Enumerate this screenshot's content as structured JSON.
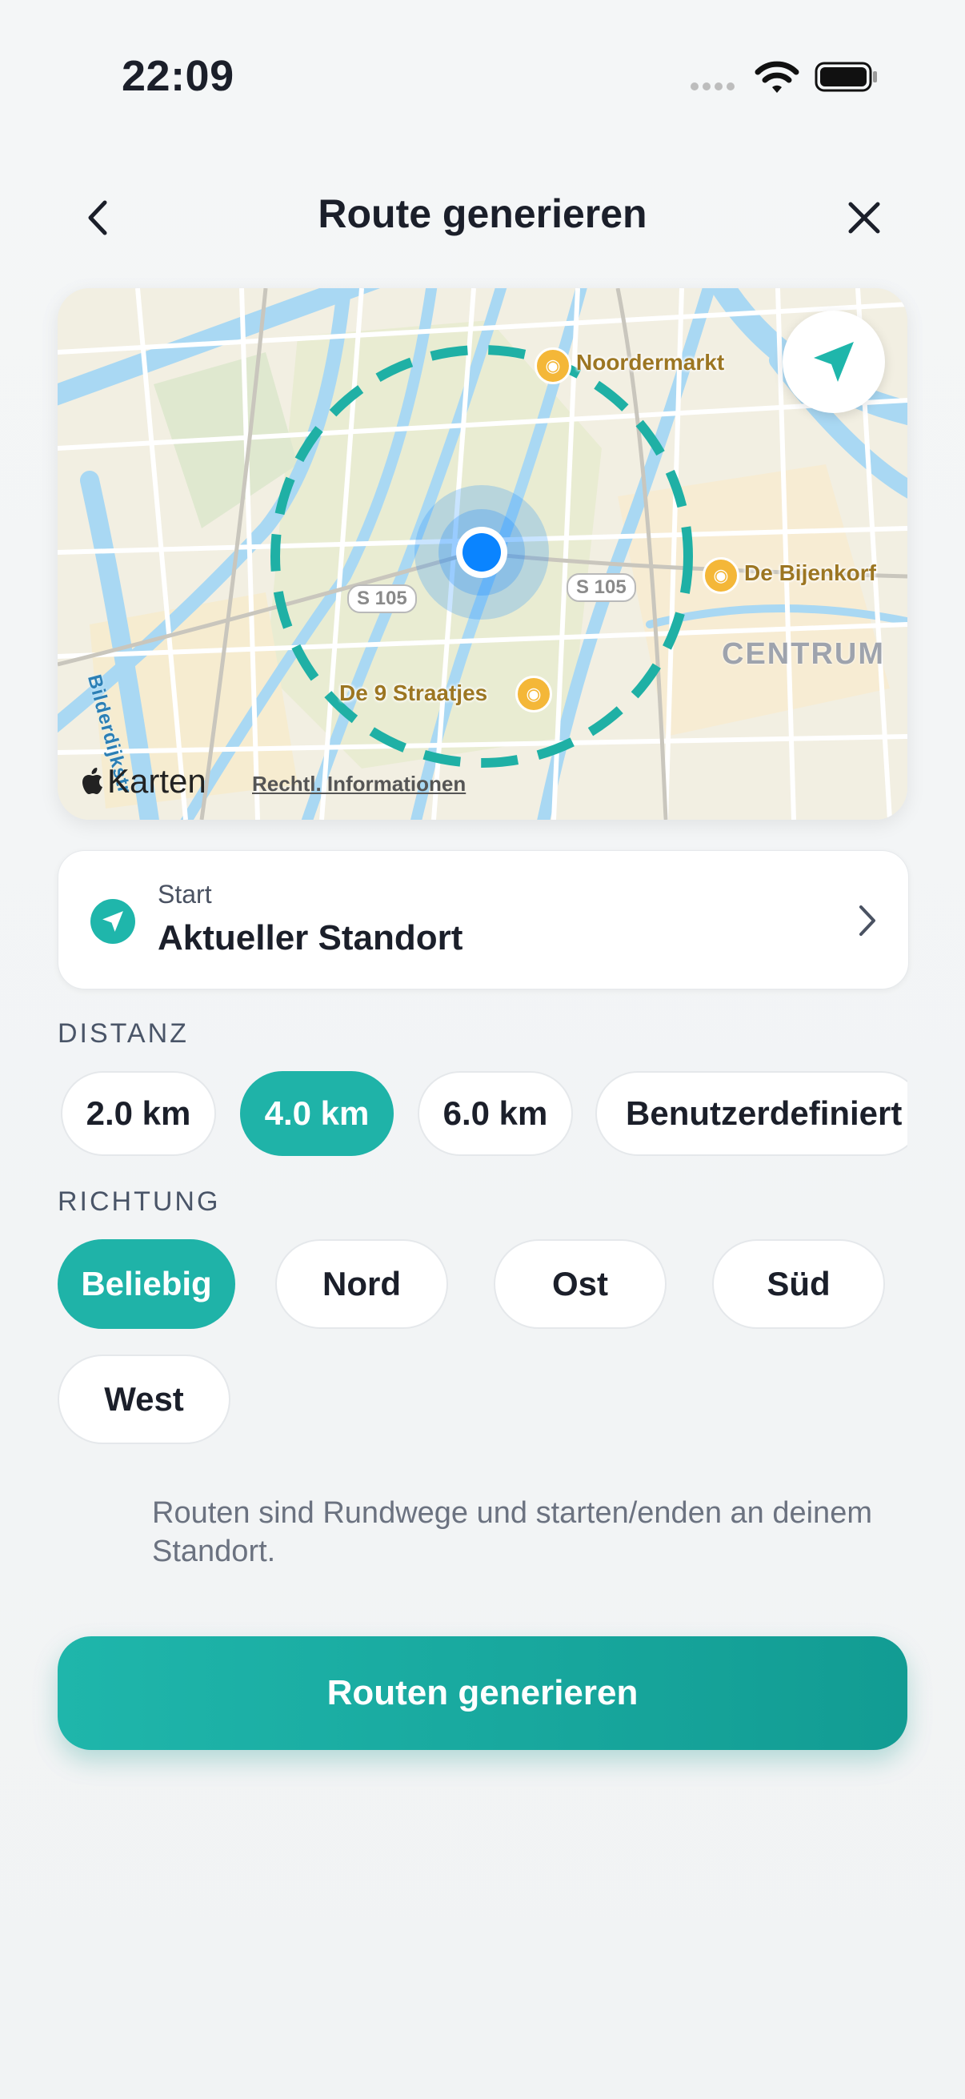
{
  "status_bar": {
    "time": "22:09"
  },
  "header": {
    "title": "Route generieren"
  },
  "map": {
    "pois": [
      {
        "name": "Noordermarkt",
        "icon": "basket-icon"
      },
      {
        "name": "De Bijenkorf",
        "icon": "shopping-bag-icon"
      },
      {
        "name": "De 9 Straatjes",
        "icon": "shopping-icon"
      }
    ],
    "road_shields": [
      "S 105",
      "S 105"
    ],
    "district_label": "CENTRUM",
    "canal_label": "Bilderdijkstr",
    "maps_brand": "Karten",
    "legal": "Rechtl. Informationen",
    "accent": "#1fb6ab"
  },
  "start": {
    "label": "Start",
    "value": "Aktueller Standort"
  },
  "distance": {
    "title": "DISTANZ",
    "options": [
      "2.0 km",
      "4.0 km",
      "6.0 km",
      "Benutzerdefiniert"
    ],
    "selected": "4.0 km"
  },
  "direction": {
    "title": "RICHTUNG",
    "options": [
      "Beliebig",
      "Nord",
      "Ost",
      "Süd",
      "West"
    ],
    "selected": "Beliebig"
  },
  "note": "Routen sind Rundwege und starten/enden an deinem Standort.",
  "cta": {
    "label": "Routen generieren"
  },
  "colors": {
    "accent": "#1fb3a8",
    "user_location": "#0a84ff"
  }
}
